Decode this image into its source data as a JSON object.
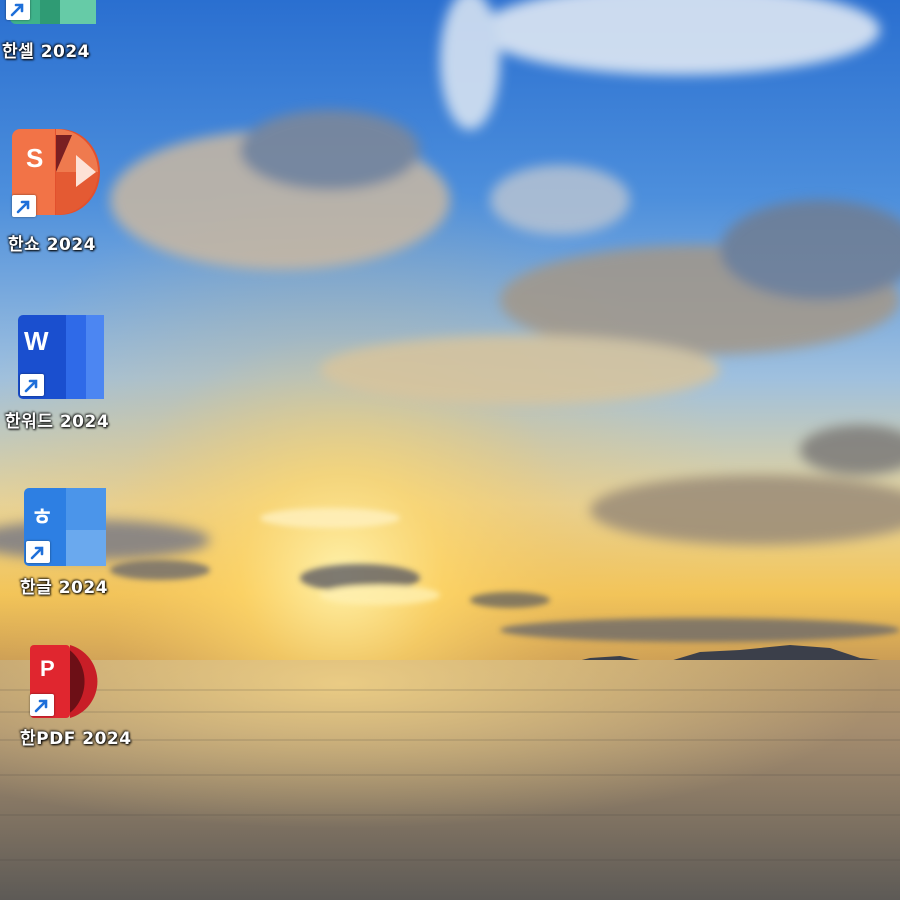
{
  "desktop": {
    "shortcuts": [
      {
        "label": "한셀 2024",
        "icon": "hancell-icon",
        "color": "#2fa679"
      },
      {
        "label": "한쇼 2024",
        "icon": "hanshow-icon",
        "color": "#ef6a3b",
        "letter": "S"
      },
      {
        "label": "한워드 2024",
        "icon": "hanword-icon",
        "color": "#1e55d6",
        "letter": "W"
      },
      {
        "label": "한글 2024",
        "icon": "hangul-icon",
        "color": "#2b7de2",
        "letter": "ㅎ"
      },
      {
        "label": "한PDF 2024",
        "icon": "hanpdf-icon",
        "color": "#d9252f",
        "letter": "P"
      }
    ],
    "shortcut_overlay": "shortcut-arrow-icon"
  }
}
